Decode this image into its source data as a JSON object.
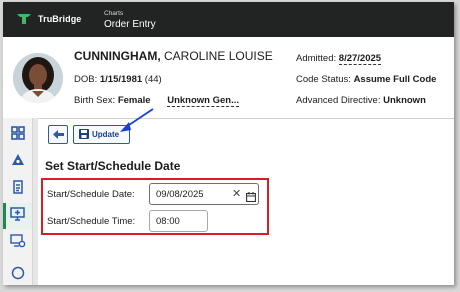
{
  "app": {
    "logo_text": "TruBridge",
    "breadcrumb_parent": "Charts",
    "page_title": "Order Entry"
  },
  "patient": {
    "last_name": "CUNNINGHAM,",
    "first_names": " CAROLINE LOUISE",
    "dob_label": "DOB:",
    "dob_value": "1/15/1981",
    "age": "(44)",
    "birth_sex_label": "Birth Sex:",
    "birth_sex_value": "Female",
    "gender_value": "Unknown Gen...",
    "admitted_label": "Admitted:",
    "admitted_value": "8/27/2025",
    "code_status_label": "Code Status:",
    "code_status_value": "Assume Full Code",
    "advanced_directive_label": "Advanced Directive:",
    "advanced_directive_value": "Unknown"
  },
  "sidebar": {
    "items": [
      {
        "icon": "dashboard-icon"
      },
      {
        "icon": "alert-triangle-icon"
      },
      {
        "icon": "document-icon"
      },
      {
        "icon": "order-entry-icon",
        "active": true
      },
      {
        "icon": "settings-screen-icon"
      }
    ]
  },
  "toolbar": {
    "back_icon": "back-arrow-icon",
    "update_label": "Update"
  },
  "form": {
    "section_title": "Set Start/Schedule Date",
    "start_date_label": "Start/Schedule Date:",
    "start_date_value": "09/08/2025",
    "start_time_label": "Start/Schedule Time:",
    "start_time_value": "08:00"
  },
  "colors": {
    "topbar": "#222323",
    "brand_green": "#1f8a4c",
    "accent_blue": "#2a5aa8",
    "highlight_red": "#d41f26",
    "annotation_arrow": "#1a3fd6"
  }
}
